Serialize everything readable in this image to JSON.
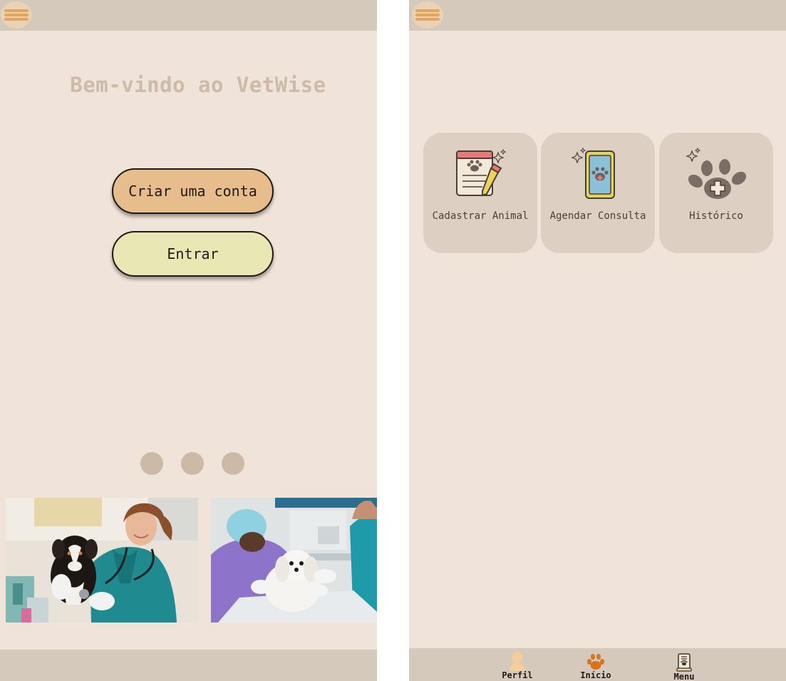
{
  "welcome": {
    "title": "Bem-vindo ao VetWise",
    "create_account_label": "Criar uma conta",
    "login_label": "Entrar",
    "carousel_total": 3
  },
  "home": {
    "cards": [
      {
        "label": "Cadastrar Animal",
        "icon": "notepad-paw-icon"
      },
      {
        "label": "Agendar Consulta",
        "icon": "phone-paw-icon"
      },
      {
        "label": "Histórico",
        "icon": "paw-plus-icon"
      }
    ],
    "nav": {
      "perfil": "Perfil",
      "inicio": "Início",
      "menu": "Menu"
    }
  },
  "colors": {
    "background": "#efe3da",
    "bar": "#d5c9bc",
    "create_button": "#e6bd8b",
    "login_button": "#e9e7b3",
    "title": "#cdbba8",
    "card": "#ddd0c3",
    "accent": "#e3a65a"
  }
}
